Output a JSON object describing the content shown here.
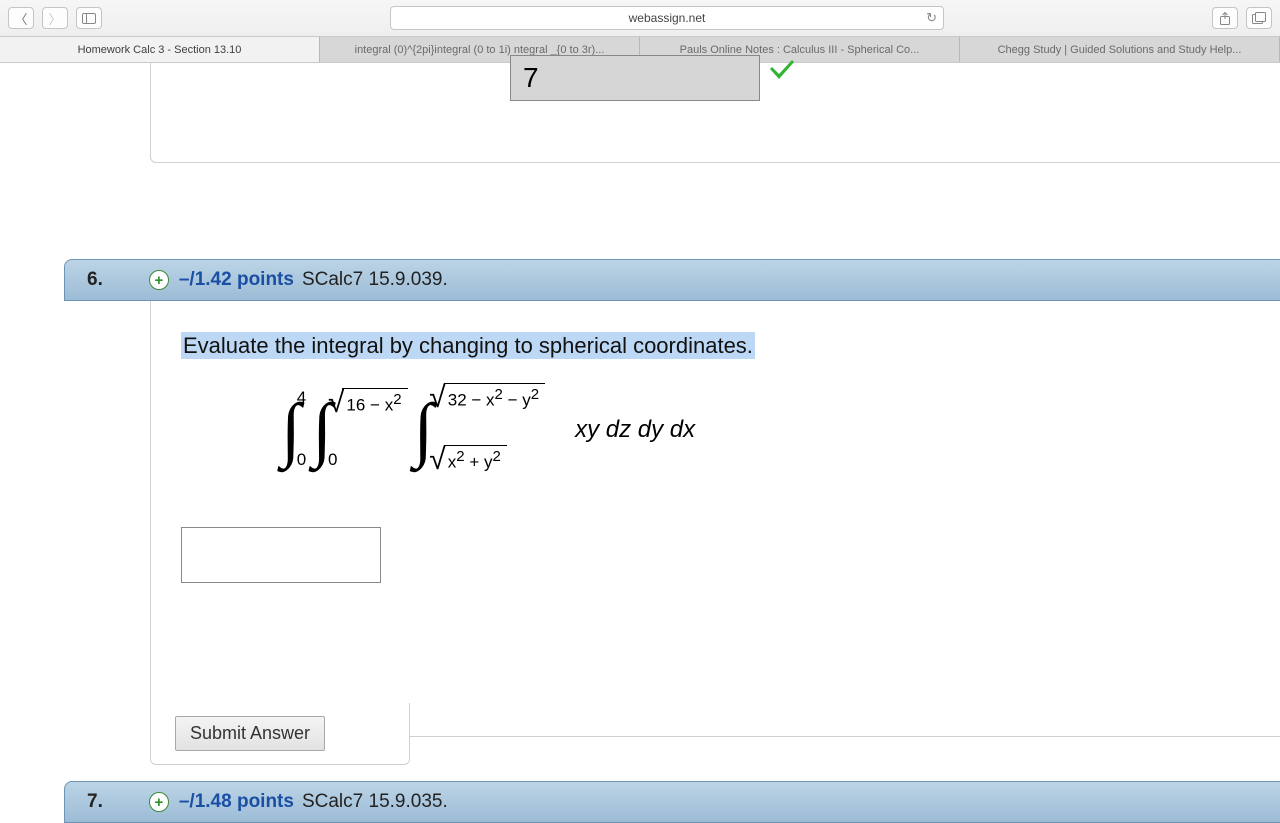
{
  "browser": {
    "url": "webassign.net",
    "tabs": [
      "Homework Calc 3 - Section 13.10",
      "integral (0)^{2pi}integral (0 to 1i) ntegral _{0 to 3r)...",
      "Pauls Online Notes : Calculus III - Spherical Co...",
      "Chegg Study | Guided Solutions and Study Help..."
    ],
    "add_tab": "+"
  },
  "prev_answer": "7",
  "q6": {
    "number": "6.",
    "expand": "+",
    "points": "–/1.42 points",
    "reference": "SCalc7 15.9.039.",
    "prompt": "Evaluate the integral by changing to spherical coordinates.",
    "outer_upper": "4",
    "outer_lower": "0",
    "mid_upper_rad": "16 − x",
    "mid_upper_exp": "2",
    "mid_lower": "0",
    "inner_upper_rad_a": "32 − x",
    "inner_upper_rad_b": " − y",
    "inner_lower_rad_a": "x",
    "inner_lower_rad_b": " + y",
    "integrand": "xy dz dy dx",
    "submit": "Submit Answer"
  },
  "q7": {
    "number": "7.",
    "expand": "+",
    "points": "–/1.48 points",
    "reference": "SCalc7 15.9.035."
  }
}
